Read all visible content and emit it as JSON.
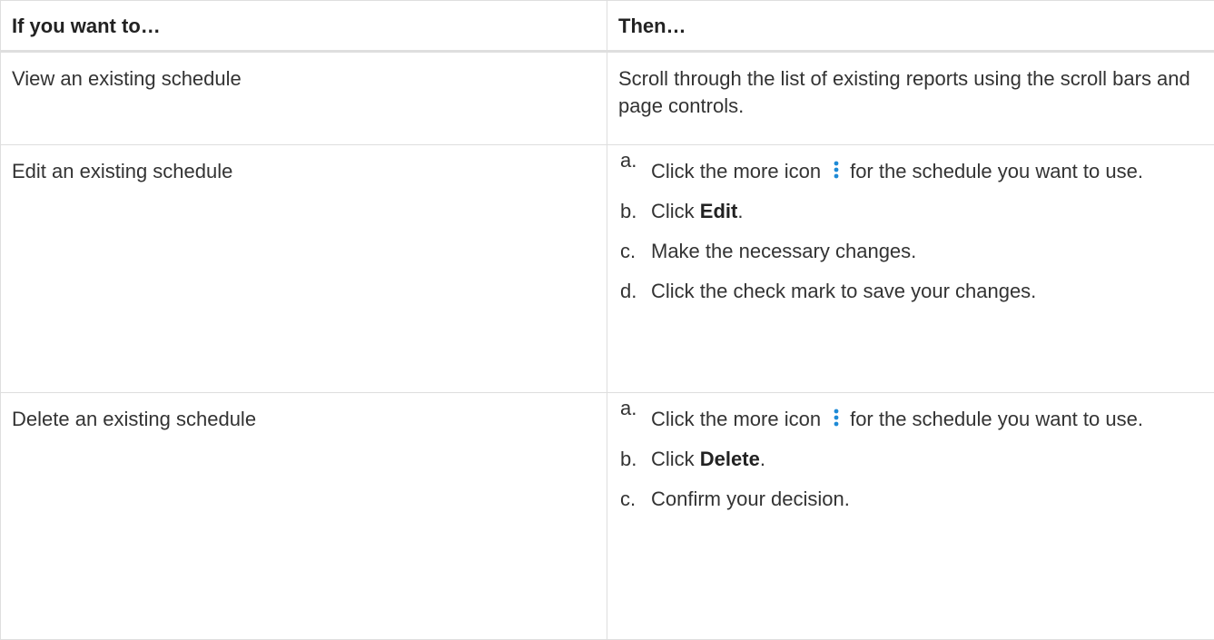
{
  "table": {
    "headers": [
      "If you want to…",
      "Then…"
    ],
    "row_view": {
      "action": "View an existing schedule",
      "then": "Scroll through the list of existing reports using the scroll bars and page controls."
    },
    "row_edit": {
      "action": "Edit an existing schedule",
      "step_a_marker": "a.",
      "step_a_pre": "Click the more icon",
      "step_a_post": "for the schedule you want to use.",
      "step_b_marker": "b.",
      "step_b_pre": "Click ",
      "step_b_bold": "Edit",
      "step_b_post": ".",
      "step_c_marker": "c.",
      "step_c_text": "Make the necessary changes.",
      "step_d_marker": "d.",
      "step_d_text": "Click the check mark to save your changes."
    },
    "row_delete": {
      "action": "Delete an existing schedule",
      "step_a_marker": "a.",
      "step_a_pre": "Click the more icon",
      "step_a_post": "for the schedule you want to use.",
      "step_b_marker": "b.",
      "step_b_pre": "Click ",
      "step_b_bold": "Delete",
      "step_b_post": ".",
      "step_c_marker": "c.",
      "step_c_text": "Confirm your decision."
    }
  },
  "icons": {
    "more": "vertical-ellipsis-icon"
  },
  "colors": {
    "icon_blue": "#1e8ad6",
    "border": "#dedede",
    "text": "#333333"
  }
}
